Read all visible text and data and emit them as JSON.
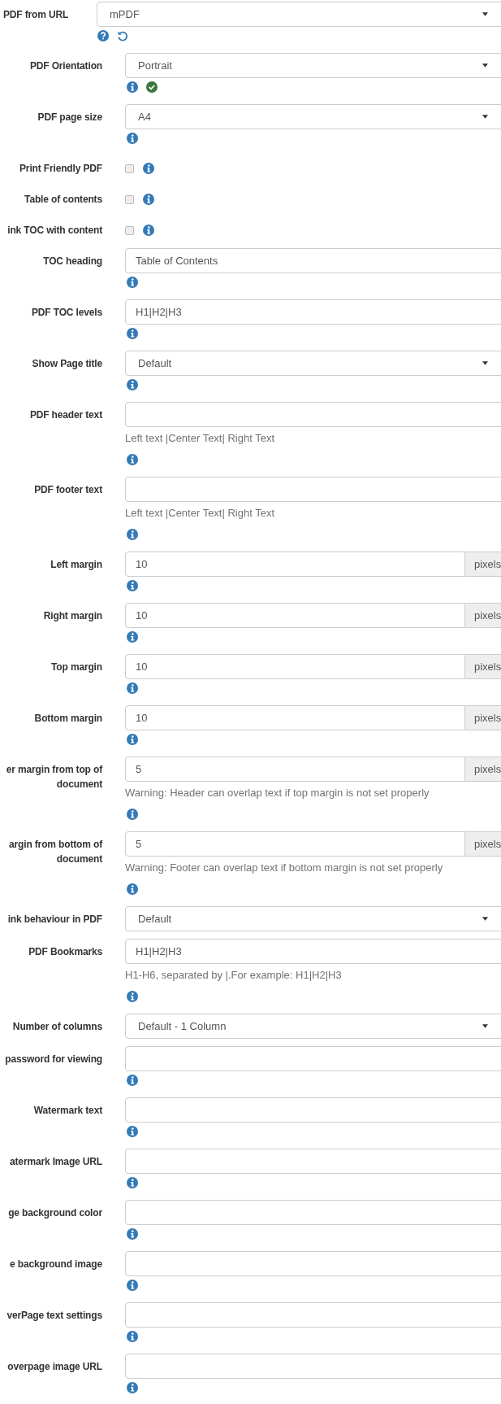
{
  "engine": {
    "label": "PDF from URL",
    "kind": "select",
    "value": "mPDF",
    "icons": [
      {
        "kind": "help"
      },
      {
        "kind": "reset"
      }
    ]
  },
  "settings": [
    {
      "label": "PDF Orientation",
      "kind": "select",
      "value": "Portrait",
      "icons": [
        {
          "kind": "info"
        },
        {
          "kind": "ok"
        }
      ]
    },
    {
      "label": "PDF page size",
      "kind": "select",
      "value": "A4",
      "icons": [
        {
          "kind": "info"
        }
      ]
    },
    {
      "label": "Print Friendly PDF",
      "kind": "checkbox",
      "checked": false,
      "icons": [
        {
          "kind": "info"
        }
      ]
    },
    {
      "label": "Table of contents",
      "kind": "checkbox",
      "checked": false,
      "icons": [
        {
          "kind": "info"
        }
      ]
    },
    {
      "label": "ink TOC with content",
      "kind": "checkbox",
      "checked": false,
      "icons": [
        {
          "kind": "info"
        }
      ]
    },
    {
      "label": "TOC heading",
      "kind": "text",
      "value": "Table of Contents",
      "icons": [
        {
          "kind": "info"
        }
      ]
    },
    {
      "label": "PDF TOC levels",
      "kind": "text",
      "value": "H1|H2|H3",
      "icons": [
        {
          "kind": "info"
        }
      ]
    },
    {
      "label": "Show Page title",
      "kind": "select",
      "value": "Default",
      "icons": [
        {
          "kind": "info"
        }
      ]
    },
    {
      "label": "PDF header text",
      "kind": "text",
      "help": "Left text |Center Text| Right Text",
      "icons": [
        {
          "kind": "info"
        }
      ]
    },
    {
      "label": "PDF footer text",
      "kind": "text",
      "help": "Left text |Center Text| Right Text",
      "icons": [
        {
          "kind": "info"
        }
      ]
    },
    {
      "label": "Left margin",
      "kind": "text",
      "value": "10",
      "addon": "pixels",
      "icons": [
        {
          "kind": "info"
        }
      ]
    },
    {
      "label": "Right margin",
      "kind": "text",
      "value": "10",
      "addon": "pixels",
      "icons": [
        {
          "kind": "info"
        }
      ]
    },
    {
      "label": "Top margin",
      "kind": "text",
      "value": "10",
      "addon": "pixels",
      "icons": [
        {
          "kind": "info"
        }
      ]
    },
    {
      "label": "Bottom margin",
      "kind": "text",
      "value": "10",
      "addon": "pixels",
      "icons": [
        {
          "kind": "info"
        }
      ]
    },
    {
      "label": "er margin from top of document",
      "kind": "text",
      "value": "5",
      "addon": "pixels",
      "help": "Warning: Header can overlap text if top margin is not set properly",
      "icons": [
        {
          "kind": "info"
        }
      ]
    },
    {
      "label": "argin from bottom of document",
      "kind": "text",
      "value": "5",
      "addon": "pixels",
      "help": "Warning: Footer can overlap text if bottom margin is not set properly",
      "icons": [
        {
          "kind": "info"
        }
      ]
    },
    {
      "label": "ink behaviour in PDF",
      "kind": "select",
      "value": "Default"
    },
    {
      "label": "PDF Bookmarks",
      "kind": "text",
      "value": "H1|H2|H3",
      "help": "H1-H6, separated by |.For example: H1|H2|H3",
      "icons": [
        {
          "kind": "info"
        }
      ]
    },
    {
      "label": "Number of columns",
      "kind": "select",
      "value": "Default - 1 Column"
    },
    {
      "label": "password for viewing",
      "kind": "text",
      "icons": [
        {
          "kind": "info"
        }
      ]
    },
    {
      "label": "Watermark text",
      "kind": "text",
      "icons": [
        {
          "kind": "info"
        }
      ]
    },
    {
      "label": "atermark Image URL",
      "kind": "text",
      "icons": [
        {
          "kind": "info"
        }
      ]
    },
    {
      "label": "ge background color",
      "kind": "text",
      "icons": [
        {
          "kind": "info"
        }
      ]
    },
    {
      "label": "e background image",
      "kind": "text",
      "icons": [
        {
          "kind": "info"
        }
      ]
    },
    {
      "label": "verPage text settings",
      "kind": "text",
      "icons": [
        {
          "kind": "info"
        }
      ]
    },
    {
      "label": "overpage image URL",
      "kind": "text",
      "icons": [
        {
          "kind": "info"
        }
      ]
    }
  ]
}
